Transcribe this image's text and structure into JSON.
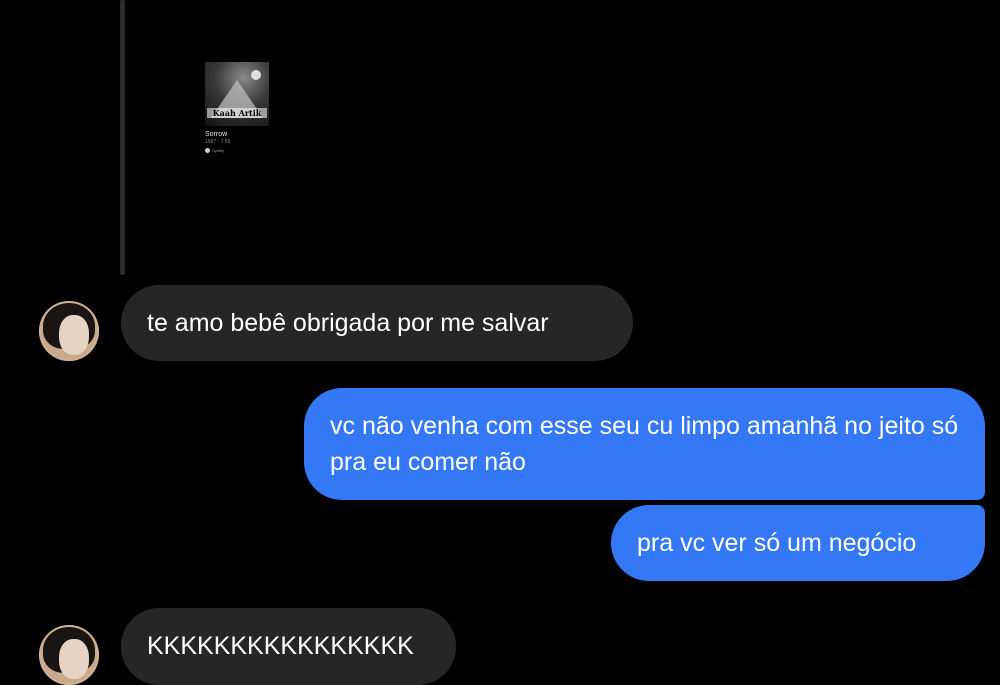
{
  "shared_music": {
    "album_logo": "Kaah Artik",
    "title": "Sorrow",
    "subtitle": "1997 · 7:59",
    "provider": "Spotify"
  },
  "messages": [
    {
      "direction": "received",
      "text": "te amo bebê obrigada por me salvar"
    },
    {
      "direction": "sent",
      "text": "vc não venha com esse seu cu limpo amanhã no jeito só pra eu comer não"
    },
    {
      "direction": "sent",
      "text": "pra vc ver só um negócio"
    },
    {
      "direction": "received",
      "text": "KKKKKKKKKKKKKKKK"
    }
  ],
  "colors": {
    "background": "#000000",
    "received_bubble": "#262626",
    "sent_bubble": "#3478f6",
    "text": "#ffffff"
  }
}
